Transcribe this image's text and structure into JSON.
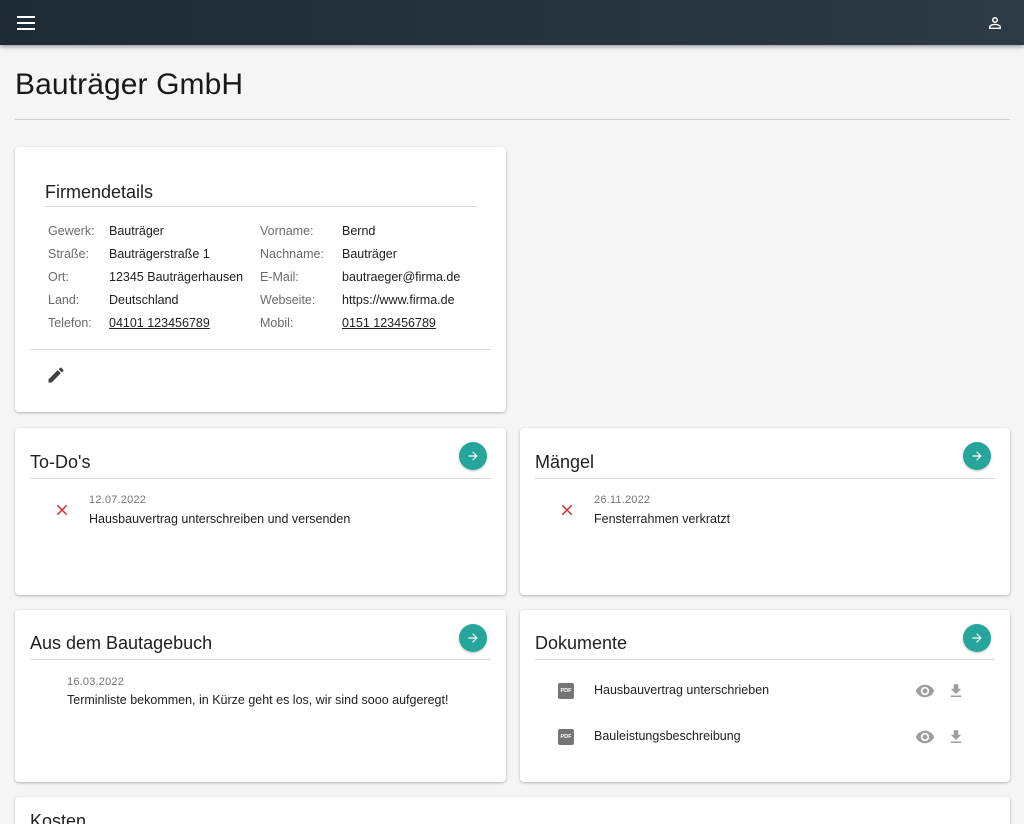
{
  "header": {
    "menu_icon": "menu-icon",
    "account_icon": "account-icon"
  },
  "page": {
    "title": "Bauträger GmbH"
  },
  "firmendetails": {
    "title": "Firmendetails",
    "left": [
      {
        "label": "Gewerk:",
        "value": "Bauträger"
      },
      {
        "label": "Straße:",
        "value": "Bauträgerstraße 1"
      },
      {
        "label": "Ort:",
        "value": "12345 Bauträgerhausen"
      },
      {
        "label": "Land:",
        "value": "Deutschland"
      },
      {
        "label": "Telefon:",
        "value": "04101 123456789"
      }
    ],
    "right": [
      {
        "label": "Vorname:",
        "value": "Bernd"
      },
      {
        "label": "Nachname:",
        "value": "Bauträger"
      },
      {
        "label": "E-Mail:",
        "value": "bautraeger@firma.de"
      },
      {
        "label": "Webseite:",
        "value": "https://www.firma.de"
      },
      {
        "label": "Mobil:",
        "value": "0151 123456789"
      }
    ],
    "edit_icon": "pencil-icon"
  },
  "todos": {
    "title": "To-Do's",
    "items": [
      {
        "date": "12.07.2022",
        "text": "Hausbauvertrag unterschreiben und versenden"
      }
    ]
  },
  "maengel": {
    "title": "Mängel",
    "items": [
      {
        "date": "26.11.2022",
        "text": "Fensterrahmen verkratzt"
      }
    ]
  },
  "bautagebuch": {
    "title": "Aus dem Bautagebuch",
    "items": [
      {
        "date": "16.03.2022",
        "text": "Terminliste bekommen, in Kürze geht es los, wir sind sooo aufgeregt!"
      }
    ]
  },
  "dokumente": {
    "title": "Dokumente",
    "items": [
      {
        "name": "Hausbauvertrag unterschrieben",
        "icon": "pdf-icon"
      },
      {
        "name": "Bauleistungsbeschreibung",
        "icon": "pdf-icon"
      }
    ],
    "pdf_badge": "PDF"
  },
  "kosten": {
    "title": "Kosten"
  },
  "colors": {
    "accent": "#26a69a",
    "error": "#d32f2f",
    "topbar": "#1d2a35"
  }
}
